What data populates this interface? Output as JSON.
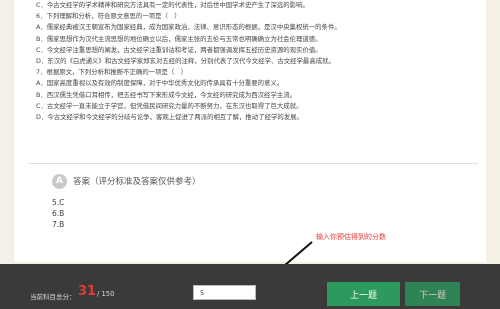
{
  "question_lines": [
    "C．今古文经学的学术精神和研究方法具有一定的代表性，对后世中国学术史产生了深远的影响。",
    "6．下列理解和分析，符合原文意思的一项是（　）",
    "A．儒家经典被汉王朝宣布为国家经典，成为国家政治、法律、意识形态的根据，是汉中央集权统一的条件。",
    "B．儒家思想作为汉代主流思想的地位确立以后，儒家主张的五伦与五常也明确确立为社会伦理道德。",
    "C．今文经学注重思想的阐发，古文经学注重训诂和考证，两者都强调发挥五经历史资源的现实价值。",
    "D．东汉的《白虎通义》和古文经学家郑玄对五经的注释，分别代表了汉代今文经学、古文经学最高成就。",
    "7．根据原文，下列分析和推断不正确的一项是（　）",
    "A．国家高度重视以及有效的制度保障，对于中华优秀文化的传承具有十分重要的意义。",
    "B．西汉儒生凭借口耳相传，把五经书写下来形成今文经，今文经的研究成为西汉经学主流。",
    "C．古文经学一直未能立于学官，但凭借民间研究力量的不断努力，在东汉也取得了巨大成就。",
    "D．今古文经学和今文经学的分歧与论争，客观上促进了两派的相互了解，推动了经学的发展。"
  ],
  "answer_section": {
    "badge": "A",
    "title": "答案（评分标准及答案仅供参考）",
    "answers": [
      "5.C",
      "6.B",
      "7.B"
    ]
  },
  "annotation": "输入你预估得到的分数",
  "bottom_bar": {
    "score_label": "当前科目总分：",
    "score_value": "31",
    "score_total": "/ 150",
    "score_input_value": "5",
    "prev_button": "上一题",
    "next_button": "下一题"
  },
  "colors": {
    "accent_red": "#e53935",
    "button_green": "#2c9a5c",
    "bar_bg": "#3a3a3a"
  }
}
